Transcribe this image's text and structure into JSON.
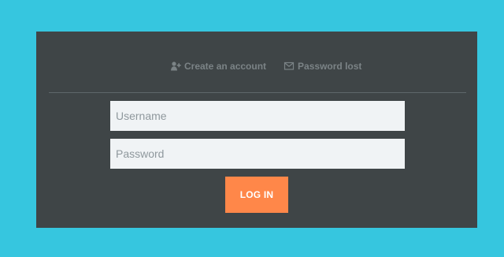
{
  "header_links": {
    "create_account": {
      "label": "Create an account",
      "icon": "user-plus-icon"
    },
    "password_lost": {
      "label": "Password lost",
      "icon": "envelope-icon"
    }
  },
  "form": {
    "username": {
      "value": "",
      "placeholder": "Username"
    },
    "password": {
      "value": "",
      "placeholder": "Password"
    },
    "login_label": "LOG IN"
  },
  "colors": {
    "page_background": "#36c6df",
    "panel_background": "#3f4547",
    "input_background": "#f0f3f5",
    "link_text": "#7b8386",
    "login_button": "#ff8749"
  }
}
